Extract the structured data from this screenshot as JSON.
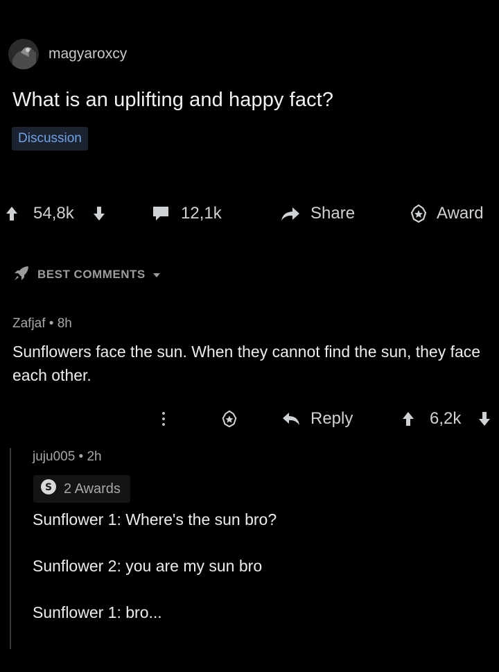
{
  "post": {
    "username": "magyaroxcy",
    "title": "What is an uplifting and happy fact?",
    "flair": "Discussion",
    "upvotes": "54,8k",
    "comments": "12,1k",
    "share_label": "Share",
    "award_label": "Award"
  },
  "sort": {
    "label": "BEST COMMENTS"
  },
  "comment": {
    "author_line": "Zafjaf • 8h",
    "body": "Sunflowers face the sun.  When they cannot find the sun, they face each other.",
    "reply_label": "Reply",
    "score": "6,2k"
  },
  "reply": {
    "author_line": "juju005 • 2h",
    "awards_label": "2 Awards",
    "lines": [
      "Sunflower 1: Where's the sun bro?",
      "Sunflower 2: you are my sun bro",
      "Sunflower 1: bro..."
    ]
  },
  "colors": {
    "background": "#000000",
    "flair_bg": "#1b2330",
    "flair_text": "#6fa2e6",
    "text": "#ededed",
    "muted": "#a8a8a8"
  },
  "icons": [
    "avatar",
    "upvote-icon",
    "downvote-icon",
    "comment-icon",
    "share-icon",
    "award-icon",
    "rocket-icon",
    "caret-down-icon",
    "more-vertical-icon",
    "reply-icon",
    "silver-award-icon"
  ]
}
